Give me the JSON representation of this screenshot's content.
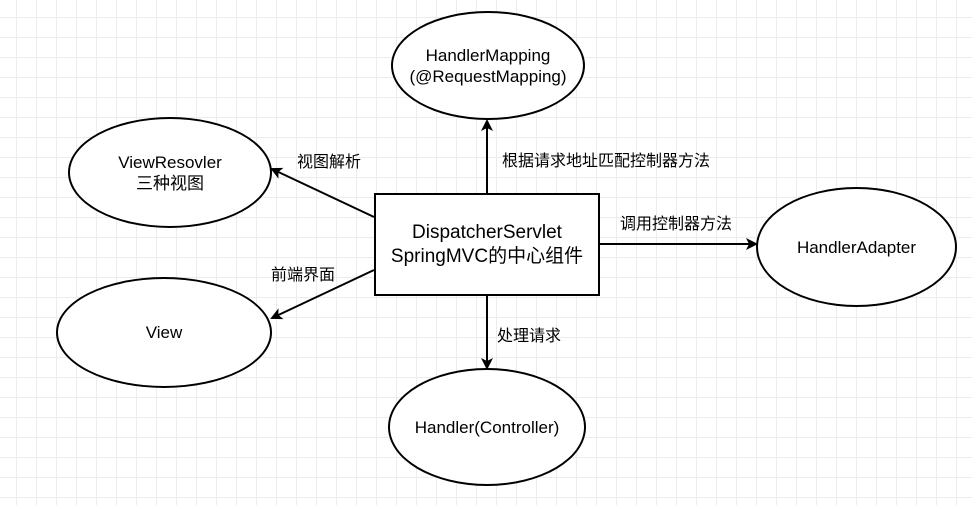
{
  "nodes": {
    "dispatcher": {
      "line1": "DispatcherServlet",
      "line2": "SpringMVC的中心组件"
    },
    "handler_mapping": {
      "line1": "HandlerMapping",
      "line2": "(@RequestMapping)"
    },
    "view_resolver": {
      "line1": "ViewResovler",
      "line2": "三种视图"
    },
    "handler_adapter": {
      "line1": "HandlerAdapter"
    },
    "view": {
      "line1": "View"
    },
    "handler": {
      "line1": "Handler(Controller)"
    }
  },
  "edges": {
    "to_handler_mapping": "根据请求地址匹配控制器方法",
    "to_view_resolver": "视图解析",
    "to_handler_adapter": "调用控制器方法",
    "to_view": "前端界面",
    "to_handler": "处理请求"
  },
  "colors": {
    "stroke": "#000000",
    "grid": "#ececec",
    "background": "#ffffff"
  }
}
